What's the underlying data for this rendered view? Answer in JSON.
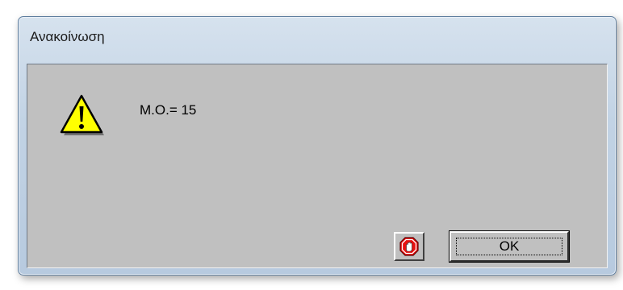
{
  "window": {
    "title": "Ανακοίνωση"
  },
  "dialog": {
    "icon": "warning-icon",
    "message": "M.O.= 15"
  },
  "buttons": {
    "stop_icon": "stop-hand-icon",
    "ok_label": "OK"
  },
  "colors": {
    "client_bg": "#c0c0c0",
    "warning_yellow": "#ffff00",
    "stop_red": "#e81010"
  }
}
